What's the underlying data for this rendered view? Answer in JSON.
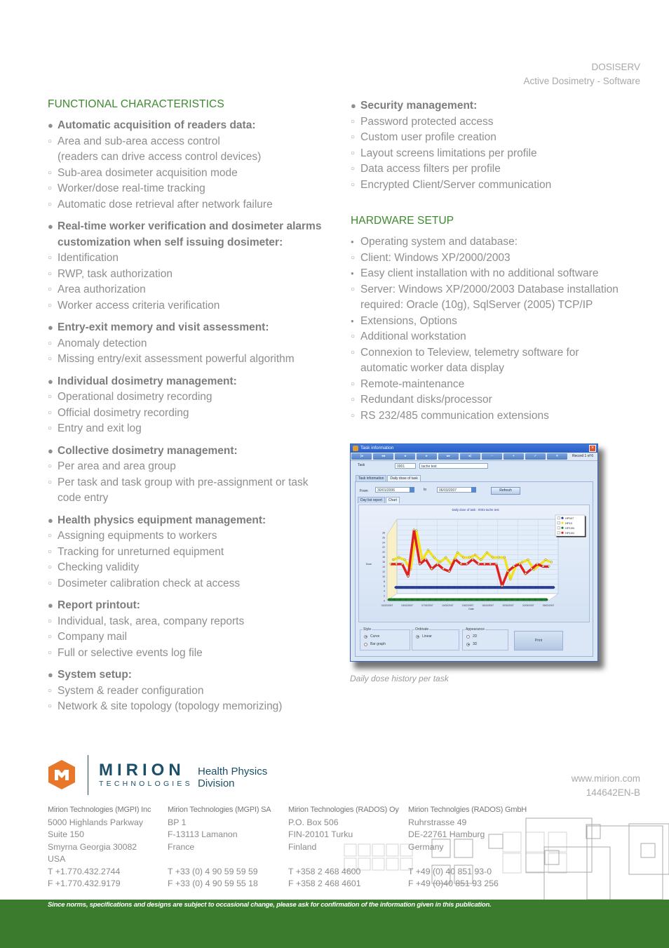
{
  "header": {
    "product": "DOSISERV",
    "subtitle": "Active Dosimetry - Software"
  },
  "functional": {
    "title": "FUNCTIONAL CHARACTERISTICS",
    "groups": [
      {
        "heading": [
          "Automatic acquisition of readers data:"
        ],
        "items": [
          [
            "Area and sub-area access control",
            "(readers can drive access control devices)"
          ],
          [
            "Sub-area dosimeter acquisition mode"
          ],
          [
            "Worker/dose real-time tracking"
          ],
          [
            "Automatic dose retrieval after network failure"
          ]
        ]
      },
      {
        "heading": [
          "Real-time worker verification and dosimeter alarms",
          "customization when self issuing dosimeter:"
        ],
        "items": [
          [
            "Identification"
          ],
          [
            "RWP, task authorization"
          ],
          [
            "Area authorization"
          ],
          [
            "Worker access criteria verification"
          ]
        ]
      },
      {
        "heading": [
          "Entry-exit memory and visit assessment:"
        ],
        "items": [
          [
            "Anomaly detection"
          ],
          [
            "Missing entry/exit assessment powerful algorithm"
          ]
        ]
      },
      {
        "heading": [
          "Individual dosimetry management:"
        ],
        "items": [
          [
            "Operational dosimetry recording"
          ],
          [
            "Official dosimetry recording"
          ],
          [
            "Entry and exit log"
          ]
        ]
      },
      {
        "heading": [
          "Collective dosimetry management:"
        ],
        "items": [
          [
            "Per area and area group"
          ],
          [
            "Per task and task group with pre-assignment or task",
            "code entry"
          ]
        ]
      },
      {
        "heading": [
          "Health physics equipment management:"
        ],
        "items": [
          [
            "Assigning equipments to workers"
          ],
          [
            "Tracking for unreturned equipment"
          ],
          [
            "Checking validity"
          ],
          [
            "Dosimeter calibration check at access"
          ]
        ]
      },
      {
        "heading": [
          "Report printout:"
        ],
        "items": [
          [
            "Individual, task, area, company reports"
          ],
          [
            "Company mail"
          ],
          [
            "Full or selective events log file"
          ]
        ]
      },
      {
        "heading": [
          "System setup:"
        ],
        "items": [
          [
            "System & reader configuration"
          ],
          [
            "Network & site topology (topology memorizing)"
          ]
        ]
      }
    ]
  },
  "security": {
    "heading": "Security management:",
    "items": [
      "Password protected access",
      "Custom user profile creation",
      "Layout screens limitations per profile",
      "Data access filters per profile",
      "Encrypted Client/Server communication"
    ]
  },
  "hardware": {
    "title": "HARDWARE SETUP",
    "lines": [
      {
        "type": "bullet",
        "text": [
          "Operating system and database:"
        ]
      },
      {
        "type": "sub",
        "text": [
          "Client: Windows XP/2000/2003"
        ]
      },
      {
        "type": "bullet",
        "text": [
          "Easy client installation with no additional software"
        ]
      },
      {
        "type": "sub",
        "text": [
          "Server: Windows XP/2000/2003 Database installation",
          "required: Oracle (10g), SqlServer (2005) TCP/IP"
        ]
      },
      {
        "type": "bullet",
        "text": [
          "Extensions, Options"
        ]
      },
      {
        "type": "sub",
        "text": [
          "Additional workstation"
        ]
      },
      {
        "type": "sub",
        "text": [
          "Connexion to Teleview, telemetry software for",
          "automatic worker data display"
        ]
      },
      {
        "type": "sub",
        "text": [
          "Remote-maintenance"
        ]
      },
      {
        "type": "sub",
        "text": [
          "Redundant disks/processor"
        ]
      },
      {
        "type": "sub",
        "text": [
          "RS 232/485 communication extensions"
        ]
      }
    ]
  },
  "screenshot": {
    "window_title": "Task information",
    "record": "Record 1 of 6",
    "task_label": "Task",
    "task_code": "0001",
    "task_name": "tache test",
    "tabs": [
      "Task information",
      "Daily dose of task"
    ],
    "from_label": "From",
    "from_date": "30/01/2006",
    "to_label": "to",
    "to_date": "06/03/2007",
    "refresh_label": "Refresh",
    "subtabs": [
      "Day list report",
      "Chart"
    ],
    "style_title": "Style",
    "style_options": [
      "Curve",
      "Bar graph"
    ],
    "style_selected": "Curve",
    "ordinate_title": "Ordinate",
    "ordinate_options": [
      "Linear"
    ],
    "appearance_title": "Appearance",
    "appearance_options": [
      "2D",
      "3D"
    ],
    "appearance_selected": "3D",
    "print_label": "Print"
  },
  "chart_data": {
    "type": "line",
    "title": "Daily dose of task : 0001-tache test",
    "xlabel": "Date",
    "ylabel": "Dose",
    "ylim": [
      0,
      30
    ],
    "yticks": [
      0,
      2,
      4,
      6,
      8,
      10,
      12,
      14,
      16,
      18,
      20,
      22,
      24,
      26,
      28
    ],
    "xticks": [
      "01/02/2007",
      "04/02/2007",
      "07/02/2007",
      "10/02/2007",
      "13/02/2007",
      "16/02/2007",
      "19/02/2007",
      "22/02/2007",
      "25/02/2007"
    ],
    "legend": [
      "HP007",
      "HP10",
      "HP10N",
      "HP10G"
    ],
    "legend_position": "right",
    "grid": true,
    "series": [
      {
        "name": "HP007",
        "color": "#2a3f9c",
        "values": [
          3,
          3,
          3,
          3,
          3,
          3,
          3,
          3,
          3,
          3,
          3,
          3,
          3,
          3,
          3,
          3,
          3,
          3,
          3,
          3,
          3,
          3,
          3,
          3,
          3,
          3,
          3,
          3
        ]
      },
      {
        "name": "HP10",
        "color": "#f2e21c",
        "values": [
          15,
          16,
          15,
          11,
          27,
          15,
          19,
          16,
          14,
          16,
          13,
          18,
          16,
          16,
          17,
          15,
          18,
          16,
          16,
          16,
          7,
          13,
          14,
          15,
          11,
          13,
          15,
          14
        ]
      },
      {
        "name": "HP10N",
        "color": "#1e7a2e",
        "values": [
          0,
          0,
          0,
          0,
          0,
          0,
          0,
          0,
          0,
          0,
          0,
          0,
          0,
          0,
          0,
          0,
          0,
          0,
          0,
          0,
          0,
          0,
          0,
          0,
          0,
          0,
          0,
          0
        ]
      },
      {
        "name": "HP10G",
        "color": "#e02020",
        "values": [
          14,
          14,
          14,
          9,
          28,
          14,
          16,
          12,
          14,
          12,
          11,
          16,
          14,
          14,
          16,
          14,
          14,
          14,
          14,
          5,
          11,
          13,
          14,
          10,
          12,
          14,
          13,
          13
        ]
      }
    ]
  },
  "caption": "Daily dose history per task",
  "logo": {
    "brand": "MIRION",
    "sub": "TECHNOLOGIES",
    "division_line1": "Health Physics",
    "division_line2": "Division",
    "hex_color": "#e8772a",
    "text_color": "#1b5068"
  },
  "web": "www.mirion.com",
  "doc_ref": "144642EN-B",
  "offices": [
    {
      "company": "Mirion Technologies (MGPI) Inc",
      "lines": [
        "5000 Highlands Parkway",
        "Suite 150",
        "Smyrna Georgia 30082",
        "USA"
      ],
      "tel": "T   +1.770.432.2744",
      "fax": "F   +1.770.432.9179"
    },
    {
      "company": "Mirion Technologies (MGPI) SA",
      "lines": [
        "BP 1",
        "F-13113 Lamanon",
        "France",
        ""
      ],
      "tel": "T   +33 (0) 4 90 59 59 59",
      "fax": "F   +33 (0) 4 90 59 55 18"
    },
    {
      "company": "Mirion Technologies (RADOS) Oy",
      "lines": [
        "P.O. Box 506",
        "FIN-20101 Turku",
        "Finland",
        ""
      ],
      "tel": "T   +358 2 468 4600",
      "fax": "F   +358 2 468 4601"
    },
    {
      "company": "Mirion Technolgies (RADOS) GmbH",
      "lines": [
        "Ruhrstrasse 49",
        "DE-22761 Hamburg",
        "Germany",
        ""
      ],
      "tel": "T   +49 (0) 40 851 93-0",
      "fax": "F   +49 (0)40 851 93 256"
    }
  ],
  "disclaimer": "Since norms, specifications and designs are subject to occasional change, please ask for confirmation of the information given in this publication.",
  "colors": {
    "accent_green": "#3c8a2e",
    "band_green": "#3a7b2d",
    "text_gray": "#8e8e8e"
  }
}
